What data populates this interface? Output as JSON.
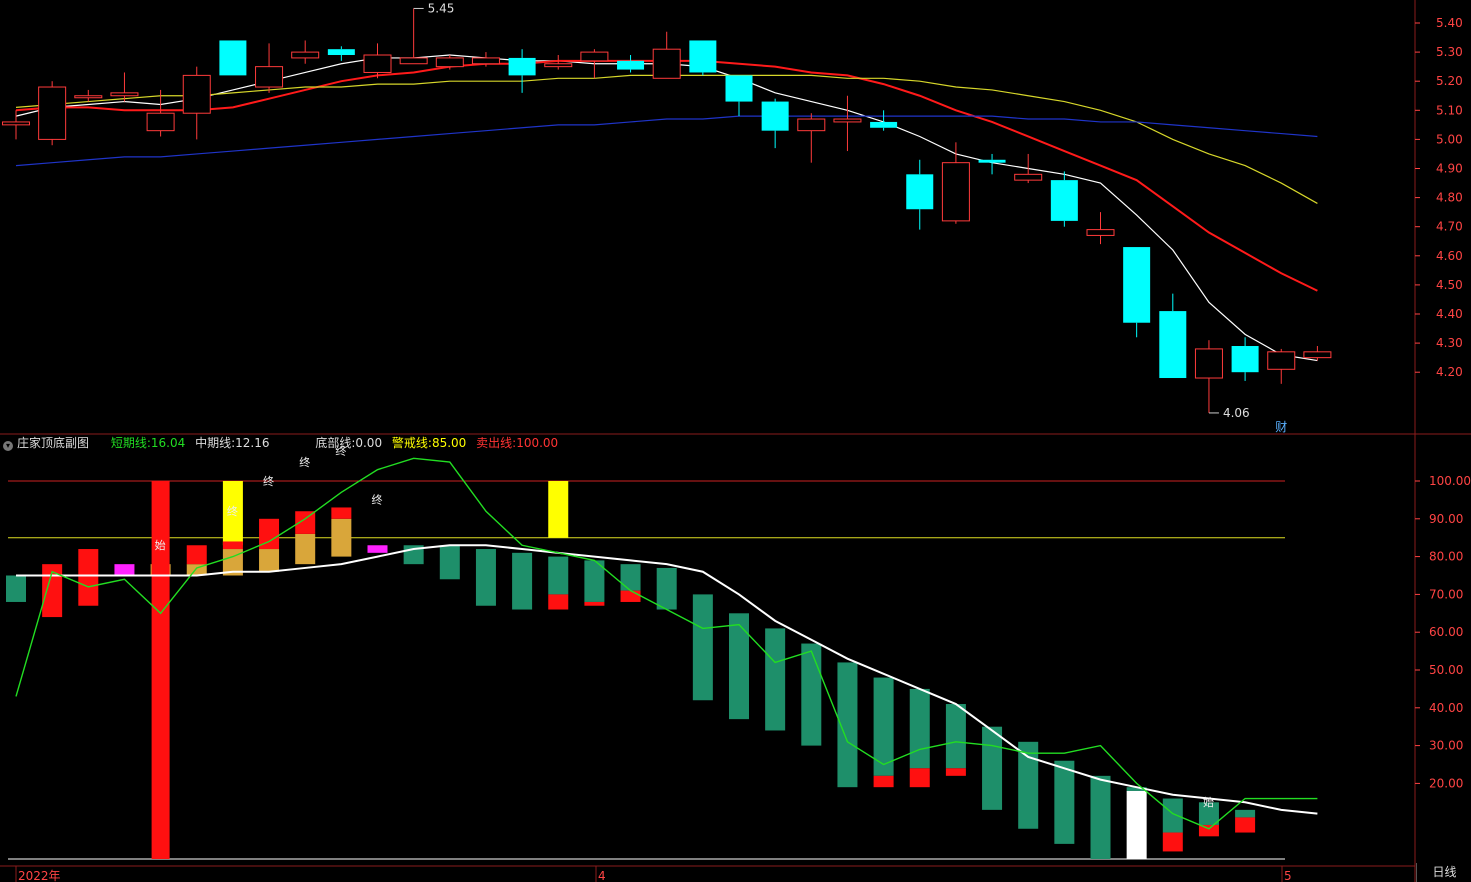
{
  "window": {
    "title_fragment": "...",
    "period_label": "日线"
  },
  "indicator": {
    "name": "庄家顶底副图",
    "short_label": "短期线:",
    "short_value": "16.04",
    "mid_label": "中期线:",
    "mid_value": "12.16",
    "bottom_label": "底部线:",
    "bottom_value": "0.00",
    "warn_label": "警戒线:",
    "warn_value": "85.00",
    "sell_label": "卖出线:",
    "sell_value": "100.00"
  },
  "colors": {
    "up": "#ff3b3b",
    "down": "#00ffff",
    "ma5": "#ffffff",
    "ma10": "#ff1a1a",
    "ma20": "#d6d62a",
    "ma60": "#1f34c9",
    "short": "#22dd22",
    "mid": "#ffffff",
    "bar_green": "#1e8f6a",
    "bar_red": "#ff1010",
    "bar_orange": "#d9a63a",
    "magenta": "#ff22ff",
    "yellow": "#ffff00",
    "axis": "#ff4444"
  },
  "chart_data": [
    {
      "type": "candlestick",
      "price_axis_ticks": [
        "5.40",
        "5.30",
        "5.20",
        "5.10",
        "5.00",
        "4.90",
        "4.80",
        "4.70",
        "4.60",
        "4.50",
        "4.40",
        "4.30",
        "4.20"
      ],
      "ylim": [
        4.0,
        5.47
      ],
      "annotations": {
        "high": "5.45",
        "low": "4.06",
        "event_marker": "财"
      },
      "x_labels": [
        "2022年",
        "4",
        "5"
      ],
      "candles": [
        {
          "o": 5.05,
          "c": 5.06,
          "h": 5.1,
          "l": 5.0
        },
        {
          "o": 5.0,
          "c": 5.18,
          "h": 5.2,
          "l": 4.98
        },
        {
          "o": 5.15,
          "c": 5.15,
          "h": 5.17,
          "l": 5.13
        },
        {
          "o": 5.15,
          "c": 5.16,
          "h": 5.23,
          "l": 5.13
        },
        {
          "o": 5.03,
          "c": 5.09,
          "h": 5.17,
          "l": 5.01
        },
        {
          "o": 5.09,
          "c": 5.22,
          "h": 5.25,
          "l": 5.0
        },
        {
          "o": 5.34,
          "c": 5.22,
          "h": 5.34,
          "l": 5.22
        },
        {
          "o": 5.18,
          "c": 5.25,
          "h": 5.33,
          "l": 5.16
        },
        {
          "o": 5.28,
          "c": 5.3,
          "h": 5.34,
          "l": 5.26
        },
        {
          "o": 5.31,
          "c": 5.29,
          "h": 5.32,
          "l": 5.27
        },
        {
          "o": 5.23,
          "c": 5.29,
          "h": 5.33,
          "l": 5.21
        },
        {
          "o": 5.26,
          "c": 5.28,
          "h": 5.45,
          "l": 5.26
        },
        {
          "o": 5.25,
          "c": 5.28,
          "h": 5.29,
          "l": 5.24
        },
        {
          "o": 5.26,
          "c": 5.28,
          "h": 5.3,
          "l": 5.25
        },
        {
          "o": 5.28,
          "c": 5.22,
          "h": 5.31,
          "l": 5.16
        },
        {
          "o": 5.25,
          "c": 5.26,
          "h": 5.29,
          "l": 5.24
        },
        {
          "o": 5.27,
          "c": 5.3,
          "h": 5.31,
          "l": 5.21
        },
        {
          "o": 5.27,
          "c": 5.24,
          "h": 5.29,
          "l": 5.23
        },
        {
          "o": 5.21,
          "c": 5.31,
          "h": 5.37,
          "l": 5.21
        },
        {
          "o": 5.34,
          "c": 5.23,
          "h": 5.34,
          "l": 5.22
        },
        {
          "o": 5.22,
          "c": 5.13,
          "h": 5.22,
          "l": 5.08
        },
        {
          "o": 5.13,
          "c": 5.03,
          "h": 5.14,
          "l": 4.97
        },
        {
          "o": 5.03,
          "c": 5.07,
          "h": 5.09,
          "l": 4.92
        },
        {
          "o": 5.06,
          "c": 5.07,
          "h": 5.15,
          "l": 4.96
        },
        {
          "o": 5.06,
          "c": 5.04,
          "h": 5.1,
          "l": 5.03
        },
        {
          "o": 4.88,
          "c": 4.76,
          "h": 4.93,
          "l": 4.69
        },
        {
          "o": 4.72,
          "c": 4.92,
          "h": 4.99,
          "l": 4.71
        },
        {
          "o": 4.93,
          "c": 4.92,
          "h": 4.95,
          "l": 4.88
        },
        {
          "o": 4.86,
          "c": 4.88,
          "h": 4.95,
          "l": 4.85
        },
        {
          "o": 4.86,
          "c": 4.72,
          "h": 4.89,
          "l": 4.7
        },
        {
          "o": 4.67,
          "c": 4.69,
          "h": 4.75,
          "l": 4.64
        },
        {
          "o": 4.63,
          "c": 4.37,
          "h": 4.63,
          "l": 4.32
        },
        {
          "o": 4.41,
          "c": 4.18,
          "h": 4.47,
          "l": 4.18
        },
        {
          "o": 4.18,
          "c": 4.28,
          "h": 4.31,
          "l": 4.06
        },
        {
          "o": 4.29,
          "c": 4.2,
          "h": 4.32,
          "l": 4.17
        },
        {
          "o": 4.21,
          "c": 4.27,
          "h": 4.28,
          "l": 4.16
        },
        {
          "o": 4.25,
          "c": 4.27,
          "h": 4.29,
          "l": 4.24
        }
      ],
      "ma_series": [
        {
          "key": "ma5",
          "values": [
            5.08,
            5.11,
            5.12,
            5.13,
            5.12,
            5.14,
            5.17,
            5.2,
            5.23,
            5.26,
            5.28,
            5.28,
            5.29,
            5.28,
            5.27,
            5.27,
            5.26,
            5.26,
            5.26,
            5.25,
            5.21,
            5.16,
            5.13,
            5.1,
            5.06,
            5.01,
            4.95,
            4.92,
            4.9,
            4.88,
            4.85,
            4.74,
            4.62,
            4.44,
            4.33,
            4.26,
            4.24
          ]
        },
        {
          "key": "ma10",
          "values": [
            5.1,
            5.11,
            5.11,
            5.1,
            5.1,
            5.1,
            5.11,
            5.14,
            5.17,
            5.2,
            5.22,
            5.23,
            5.25,
            5.26,
            5.26,
            5.27,
            5.27,
            5.27,
            5.27,
            5.27,
            5.26,
            5.25,
            5.23,
            5.22,
            5.19,
            5.15,
            5.1,
            5.06,
            5.01,
            4.96,
            4.91,
            4.86,
            4.77,
            4.68,
            4.61,
            4.54,
            4.48
          ]
        },
        {
          "key": "ma20",
          "values": [
            5.11,
            5.12,
            5.13,
            5.14,
            5.15,
            5.15,
            5.16,
            5.17,
            5.18,
            5.18,
            5.19,
            5.19,
            5.2,
            5.2,
            5.2,
            5.21,
            5.21,
            5.22,
            5.22,
            5.22,
            5.22,
            5.22,
            5.22,
            5.21,
            5.21,
            5.2,
            5.18,
            5.17,
            5.15,
            5.13,
            5.1,
            5.06,
            5.0,
            4.95,
            4.91,
            4.85,
            4.78
          ]
        },
        {
          "key": "ma60",
          "values": [
            4.91,
            4.92,
            4.93,
            4.94,
            4.94,
            4.95,
            4.96,
            4.97,
            4.98,
            4.99,
            5.0,
            5.01,
            5.02,
            5.03,
            5.04,
            5.05,
            5.05,
            5.06,
            5.07,
            5.07,
            5.08,
            5.08,
            5.08,
            5.08,
            5.08,
            5.08,
            5.08,
            5.08,
            5.07,
            5.07,
            5.06,
            5.06,
            5.05,
            5.04,
            5.03,
            5.02,
            5.01
          ]
        }
      ]
    },
    {
      "type": "bar+line",
      "title": "庄家顶底副图",
      "value_axis_ticks": [
        "100.00",
        "90.00",
        "80.00",
        "70.00",
        "60.00",
        "50.00",
        "40.00",
        "30.00",
        "20.00"
      ],
      "ylim": [
        0,
        110
      ],
      "reference_lines": {
        "bottom": 0,
        "warn": 85,
        "sell": 100
      },
      "short_line": [
        43,
        76,
        72,
        74,
        65,
        77,
        80,
        84,
        90,
        97,
        103,
        106,
        105,
        92,
        83,
        81,
        79,
        71,
        66,
        61,
        62,
        52,
        55,
        31,
        25,
        29,
        31,
        30,
        28,
        28,
        30,
        20,
        12,
        8,
        16,
        16,
        16
      ],
      "mid_line": [
        75,
        75,
        75,
        75,
        75,
        75,
        76,
        76,
        77,
        78,
        80,
        82,
        83,
        83,
        82,
        81,
        80,
        79,
        78,
        76,
        70,
        63,
        58,
        53,
        49,
        45,
        41,
        34,
        27,
        24,
        21,
        19,
        17,
        16,
        15,
        13,
        12
      ],
      "bars": [
        {
          "g": [
            75,
            68
          ]
        },
        {
          "r": [
            78,
            64
          ]
        },
        {
          "r": [
            82,
            67
          ]
        },
        {
          "m": [
            78,
            75
          ]
        },
        {
          "r": [
            100,
            0
          ],
          "o": [
            78,
            75
          ]
        },
        {
          "r": [
            83,
            78
          ],
          "o": [
            78,
            75
          ]
        },
        {
          "y": [
            100,
            83
          ],
          "r": [
            84,
            82
          ],
          "o": [
            82,
            75
          ]
        },
        {
          "r": [
            90,
            82
          ],
          "o": [
            82,
            76
          ]
        },
        {
          "r": [
            92,
            86
          ],
          "o": [
            86,
            78
          ]
        },
        {
          "r": [
            93,
            90
          ],
          "o": [
            90,
            80
          ]
        },
        {
          "m": [
            83,
            81
          ]
        },
        {
          "g": [
            83,
            78
          ]
        },
        {
          "g": [
            83,
            74
          ]
        },
        {
          "g": [
            82,
            67
          ]
        },
        {
          "g": [
            81,
            66
          ]
        },
        {
          "y": [
            100,
            85
          ],
          "g": [
            80,
            70
          ],
          "r": [
            70,
            66
          ]
        },
        {
          "g": [
            79,
            68
          ],
          "r": [
            68,
            67
          ]
        },
        {
          "g": [
            78,
            71
          ],
          "r": [
            71,
            68
          ]
        },
        {
          "g": [
            77,
            66
          ]
        },
        {
          "g": [
            70,
            42
          ]
        },
        {
          "g": [
            65,
            37
          ]
        },
        {
          "g": [
            61,
            34
          ]
        },
        {
          "g": [
            57,
            30
          ]
        },
        {
          "g": [
            52,
            19
          ]
        },
        {
          "g": [
            48,
            22
          ],
          "r": [
            22,
            19
          ]
        },
        {
          "g": [
            45,
            24
          ],
          "r": [
            24,
            19
          ]
        },
        {
          "g": [
            41,
            24
          ],
          "r": [
            24,
            22
          ]
        },
        {
          "g": [
            35,
            13
          ]
        },
        {
          "g": [
            31,
            8
          ]
        },
        {
          "g": [
            26,
            4
          ]
        },
        {
          "g": [
            22,
            0
          ]
        },
        {
          "w": [
            18,
            0
          ],
          "g": [
            19,
            18
          ]
        },
        {
          "g": [
            16,
            7
          ],
          "r": [
            7,
            2
          ]
        },
        {
          "g": [
            15,
            9
          ],
          "r": [
            9,
            6
          ]
        },
        {
          "g": [
            13,
            11
          ],
          "r": [
            11,
            7
          ]
        }
      ],
      "text_labels": [
        {
          "i": 4,
          "v": 82,
          "t": "始"
        },
        {
          "i": 6,
          "v": 91,
          "t": "终"
        },
        {
          "i": 7,
          "v": 99,
          "t": "终"
        },
        {
          "i": 8,
          "v": 104,
          "t": "终"
        },
        {
          "i": 9,
          "v": 107,
          "t": "终"
        },
        {
          "i": 10,
          "v": 94,
          "t": "终"
        },
        {
          "i": 33,
          "v": 14,
          "t": "始"
        }
      ]
    }
  ]
}
